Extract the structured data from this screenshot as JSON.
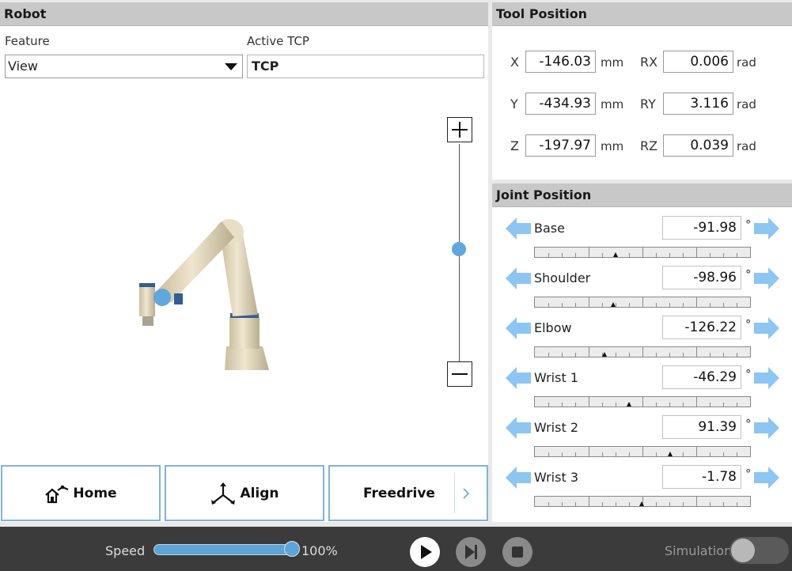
{
  "robot_panel": {
    "title": "Robot",
    "feature_label": "Feature",
    "feature_value": "View",
    "tcp_label": "Active TCP",
    "tcp_value": "TCP",
    "buttons": {
      "home": "Home",
      "align": "Align",
      "freedrive": "Freedrive"
    }
  },
  "tool_panel": {
    "title": "Tool Position",
    "coords": [
      {
        "label": "X",
        "value": "-146.03",
        "unit": "mm"
      },
      {
        "label": "Y",
        "value": "-434.93",
        "unit": "mm"
      },
      {
        "label": "Z",
        "value": "-197.97",
        "unit": "mm"
      },
      {
        "label": "RX",
        "value": "0.006",
        "unit": "rad"
      },
      {
        "label": "RY",
        "value": "3.116",
        "unit": "rad"
      },
      {
        "label": "RZ",
        "value": "0.039",
        "unit": "rad"
      }
    ]
  },
  "joint_panel": {
    "title": "Joint Position",
    "degree_symbol": "°",
    "joints": [
      {
        "name": "Base",
        "value": "-91.98",
        "slider_fraction": 0.376
      },
      {
        "name": "Shoulder",
        "value": "-98.96",
        "slider_fraction": 0.365
      },
      {
        "name": "Elbow",
        "value": "-126.22",
        "slider_fraction": 0.325
      },
      {
        "name": "Wrist 1",
        "value": "-46.29",
        "slider_fraction": 0.438
      },
      {
        "name": "Wrist 2",
        "value": "91.39",
        "slider_fraction": 0.627
      },
      {
        "name": "Wrist 3",
        "value": "-1.78",
        "slider_fraction": 0.497
      }
    ]
  },
  "bottom_bar": {
    "speed_label": "Speed",
    "speed_value": "100%",
    "speed_fraction": 1.0,
    "simulation_label": "Simulation",
    "simulation_on": false
  },
  "colors": {
    "accent": "#5ea7df",
    "arrow": "#8cc6f2",
    "header": "#c8c8c8",
    "bar": "#3b3b3b"
  }
}
